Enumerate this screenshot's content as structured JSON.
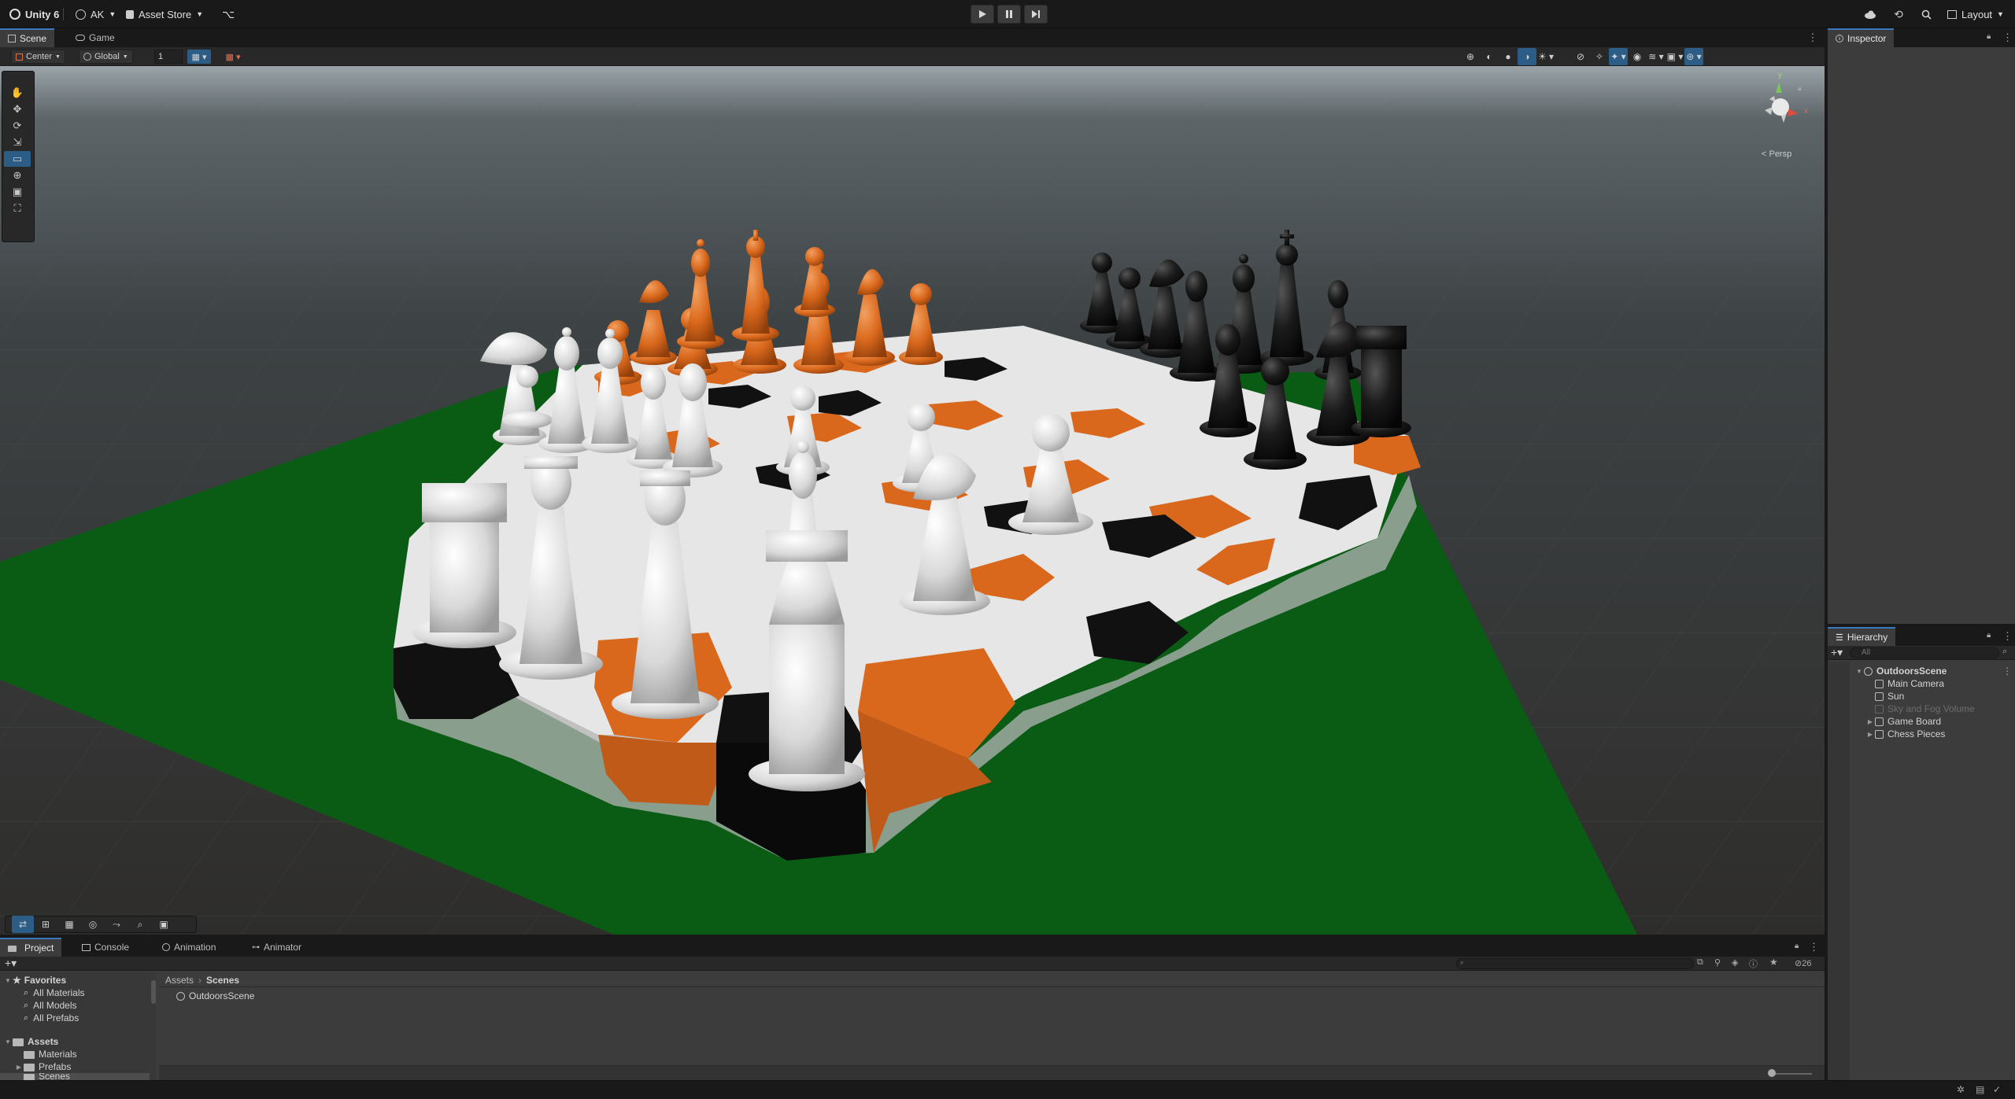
{
  "topbar": {
    "unity_label": "Unity 6",
    "account_label": "AK",
    "asset_store_label": "Asset Store",
    "layout_label": "Layout"
  },
  "scene_tabs": [
    "Scene",
    "Game"
  ],
  "scene_toolbar": {
    "pivot_label": "Center",
    "space_label": "Global",
    "snap_value": "1",
    "camera_mode": "< Persp",
    "axes": {
      "y": "y",
      "x": "x"
    }
  },
  "inspector": {
    "title": "Inspector"
  },
  "hierarchy": {
    "title": "Hierarchy",
    "search_placeholder": "All",
    "scene_name": "OutdoorsScene",
    "items": [
      {
        "label": "Main Camera",
        "expandable": false,
        "disabled": false
      },
      {
        "label": "Sun",
        "expandable": false,
        "disabled": false
      },
      {
        "label": "Sky and Fog Volume",
        "expandable": false,
        "disabled": true
      },
      {
        "label": "Game Board",
        "expandable": true,
        "disabled": false
      },
      {
        "label": "Chess Pieces",
        "expandable": true,
        "disabled": false
      }
    ]
  },
  "bottom_tabs": [
    "Project",
    "Console",
    "Animation",
    "Animator"
  ],
  "project": {
    "favorites_title": "Favorites",
    "favorites": [
      "All Materials",
      "All Models",
      "All Prefabs"
    ],
    "assets_title": "Assets",
    "asset_folders": [
      "Materials",
      "Prefabs",
      "Scenes"
    ],
    "breadcrumb": [
      "Assets",
      "Scenes"
    ],
    "files": [
      "OutdoorsScene"
    ],
    "hidden_count": "26"
  },
  "colors": {
    "accent": "#3a79bb",
    "board_orange": "#d9681c",
    "board_white": "#e8e8e8",
    "board_black": "#111111",
    "ground_green": "#0a5c14"
  }
}
